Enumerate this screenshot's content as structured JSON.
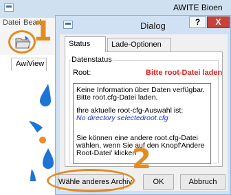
{
  "app": {
    "title": "AWITE Bioen",
    "menu": [
      "Datei",
      "Bearb"
    ],
    "left_tab": "AwiView"
  },
  "dialog": {
    "title": "Dialog",
    "help_label": "?",
    "close_label": "X",
    "tabs": [
      "Status",
      "Lade-Optionen"
    ],
    "group_title": "Datenstatus",
    "root_label": "Root:",
    "root_value": "Bitte root-Datei laden",
    "info": {
      "line1": "Keine Information über Daten verfügbar. Bitte root.cfg-Datei laden.",
      "line2": "Ihre aktuelle root-cfg-Auswahl ist:",
      "path": "No directory selectedroot.cfg",
      "line3": "Sie können eine andere root.cfg-Datei wählen, wenn Sie auf den Knopf'Andere Root-Datei' klicken"
    },
    "buttons": {
      "choose_archive": "Wähle anderes Archiv",
      "ok": "OK",
      "cancel": "Abbruch"
    }
  },
  "annotations": {
    "step1": "1",
    "step2": "2",
    "color": "#e38b21"
  },
  "colors": {
    "root_value": "#e0201f",
    "path": "#1c2fc8",
    "close_button": "#c7403a",
    "dialog_frame": "#cfe1f3"
  },
  "icons": {
    "toolbar_open": "open-folder-icon",
    "logo": "awite-logo-icon"
  }
}
